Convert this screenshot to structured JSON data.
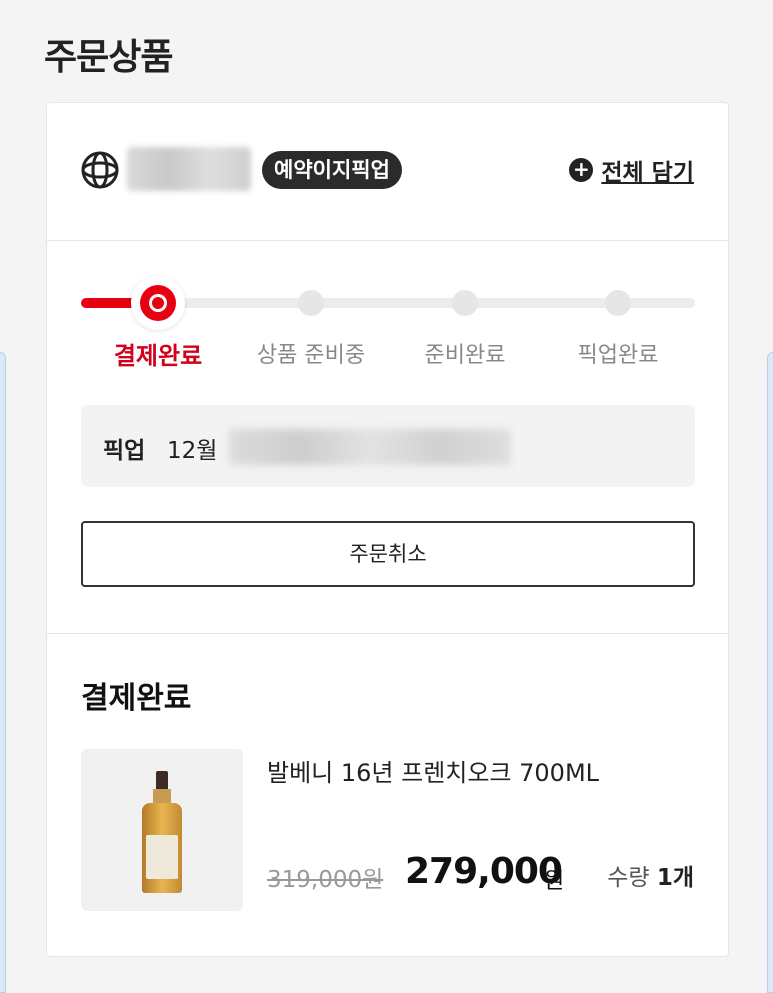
{
  "section_title": "주문상품",
  "store": {
    "badge": "예약이지픽업",
    "add_all_label": "전체 담기",
    "add_all_icon": "plus-circle-icon"
  },
  "steps": [
    {
      "label": "결제완료",
      "active": true
    },
    {
      "label": "상품 준비중",
      "active": false
    },
    {
      "label": "준비완료",
      "active": false
    },
    {
      "label": "픽업완료",
      "active": false
    }
  ],
  "pickup": {
    "label": "픽업",
    "month": "12월"
  },
  "cancel_label": "주문취소",
  "status_title": "결제완료",
  "product": {
    "name": "발베니 16년 프렌치오크 700ML",
    "original_price": "319,000원",
    "price": "279,000",
    "price_unit": "원",
    "qty_label": "수량",
    "qty_value": "1개"
  },
  "colors": {
    "accent": "#e60012",
    "active_step_text": "#d0021b"
  }
}
